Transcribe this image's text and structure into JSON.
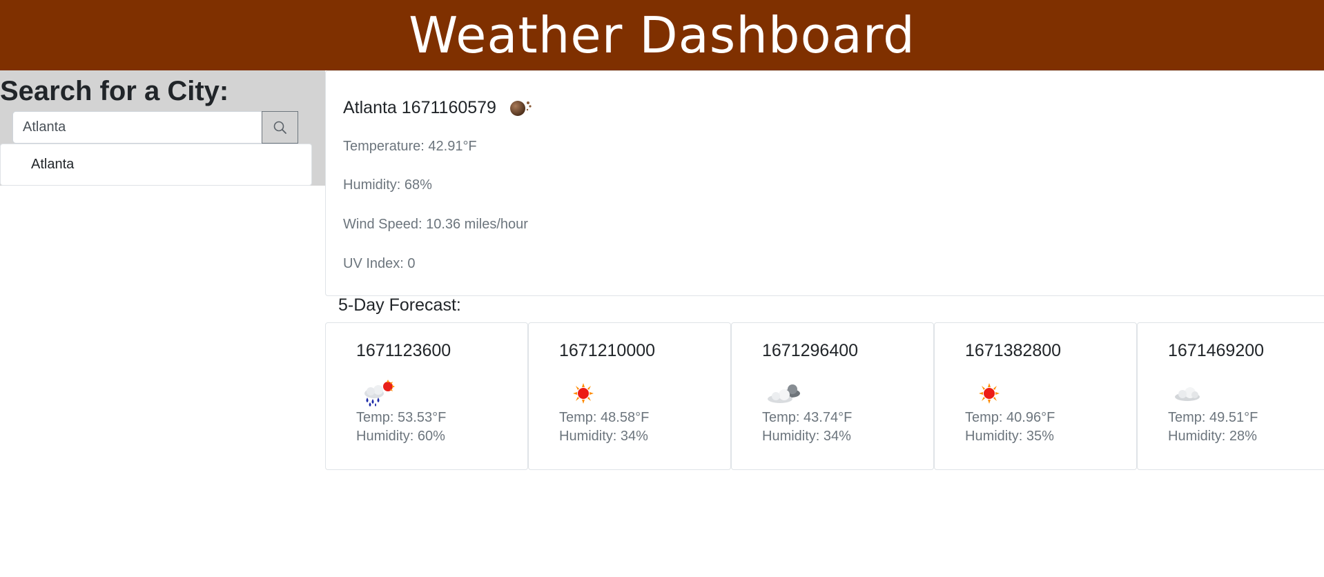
{
  "header": {
    "title": "Weather Dashboard"
  },
  "colors": {
    "header_bg": "#7f3000",
    "sidebar_bg": "#d3d3d3"
  },
  "sidebar": {
    "heading": "Search for a City:",
    "search": {
      "value": "Atlanta",
      "icon": "search-icon"
    },
    "history": [
      {
        "label": "Atlanta"
      }
    ]
  },
  "current": {
    "title": "Atlanta 1671160579",
    "icon": "night-moon-icon",
    "temperature": "Temperature: 42.91°F",
    "humidity": "Humidity: 68%",
    "wind": "Wind Speed: 10.36 miles/hour",
    "uv": "UV Index: 0"
  },
  "forecast": {
    "title": "5-Day Forecast:",
    "days": [
      {
        "date": "1671123600",
        "icon": "rain-sun-icon",
        "temp": "Temp: 53.53°F",
        "humidity": "Humidity: 60%"
      },
      {
        "date": "1671210000",
        "icon": "sun-icon",
        "temp": "Temp: 48.58°F",
        "humidity": "Humidity: 34%"
      },
      {
        "date": "1671296400",
        "icon": "broken-clouds-icon",
        "temp": "Temp: 43.74°F",
        "humidity": "Humidity: 34%"
      },
      {
        "date": "1671382800",
        "icon": "sun-icon",
        "temp": "Temp: 40.96°F",
        "humidity": "Humidity: 35%"
      },
      {
        "date": "1671469200",
        "icon": "cloud-icon",
        "temp": "Temp: 49.51°F",
        "humidity": "Humidity: 28%"
      }
    ]
  }
}
